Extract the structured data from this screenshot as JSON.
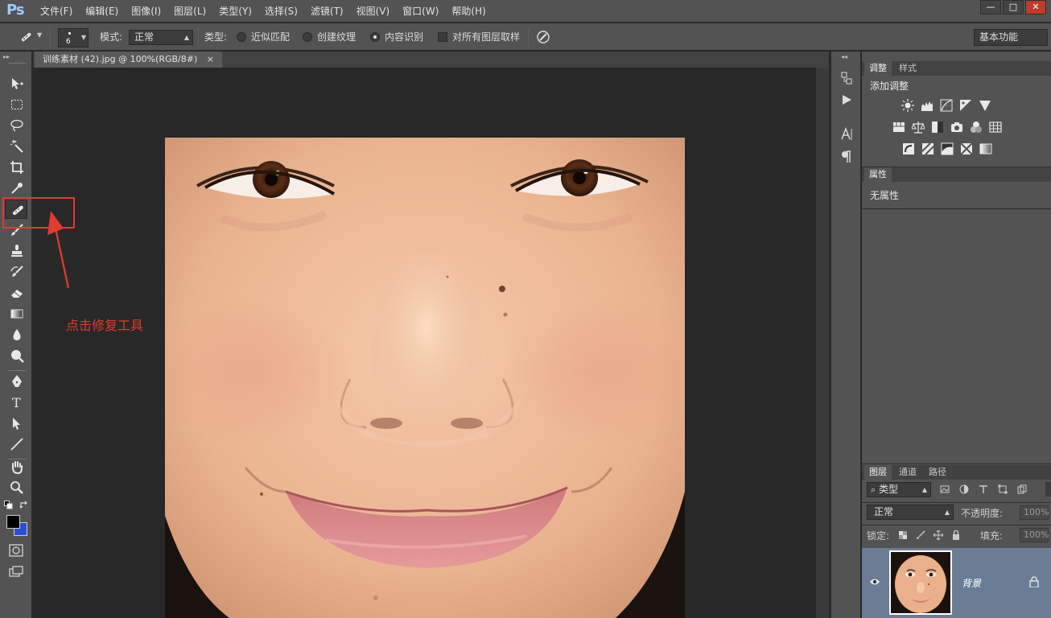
{
  "app": {
    "logo": "Ps"
  },
  "menu": [
    "文件(F)",
    "编辑(E)",
    "图像(I)",
    "图层(L)",
    "类型(Y)",
    "选择(S)",
    "滤镜(T)",
    "视图(V)",
    "窗口(W)",
    "帮助(H)"
  ],
  "window_controls": {
    "minimize": "—",
    "maximize": "□",
    "close": "✕"
  },
  "options": {
    "brush_size": "6",
    "mode_label": "模式:",
    "mode_value": "正常",
    "type_label": "类型:",
    "type_options": [
      "近似匹配",
      "创建纹理",
      "内容识别"
    ],
    "type_selected": "内容识别",
    "sample_all_label": "对所有图层取样",
    "workspace": "基本功能"
  },
  "document": {
    "tab_title": "训练素材 (42).jpg @ 100%(RGB/8#)",
    "tab_close": "×"
  },
  "annotation": {
    "text": "点击修复工具",
    "color": "#e23b30"
  },
  "colors": {
    "foreground": "#000000",
    "background": "#2b4ed8",
    "accent": "#e23b30"
  },
  "tools": [
    "move-tool-icon",
    "marquee-tool-icon",
    "lasso-tool-icon",
    "magic-wand-icon",
    "crop-tool-icon",
    "eyedropper-icon",
    "spot-healing-brush-icon",
    "brush-tool-icon",
    "clone-stamp-icon",
    "history-brush-icon",
    "eraser-icon",
    "gradient-icon",
    "blur-icon",
    "dodge-icon",
    "pen-tool-icon",
    "type-tool-icon",
    "path-selection-icon",
    "line-tool-icon",
    "hand-tool-icon",
    "zoom-tool-icon"
  ],
  "active_tool": "spot-healing-brush-icon",
  "type_tool_glyph": "T",
  "panels": {
    "adjustments": {
      "tabs": [
        "调整",
        "样式"
      ],
      "title": "添加调整"
    },
    "properties": {
      "tab": "属性",
      "text": "无属性"
    },
    "layers": {
      "tabs": [
        "图层",
        "通道",
        "路径"
      ],
      "filter_kind": "类型",
      "blend_mode": "正常",
      "opacity_label": "不透明度:",
      "opacity_value": "100%",
      "lock_label": "锁定:",
      "fill_label": "填充:",
      "fill_value": "100%",
      "layer_name": "背景"
    }
  }
}
